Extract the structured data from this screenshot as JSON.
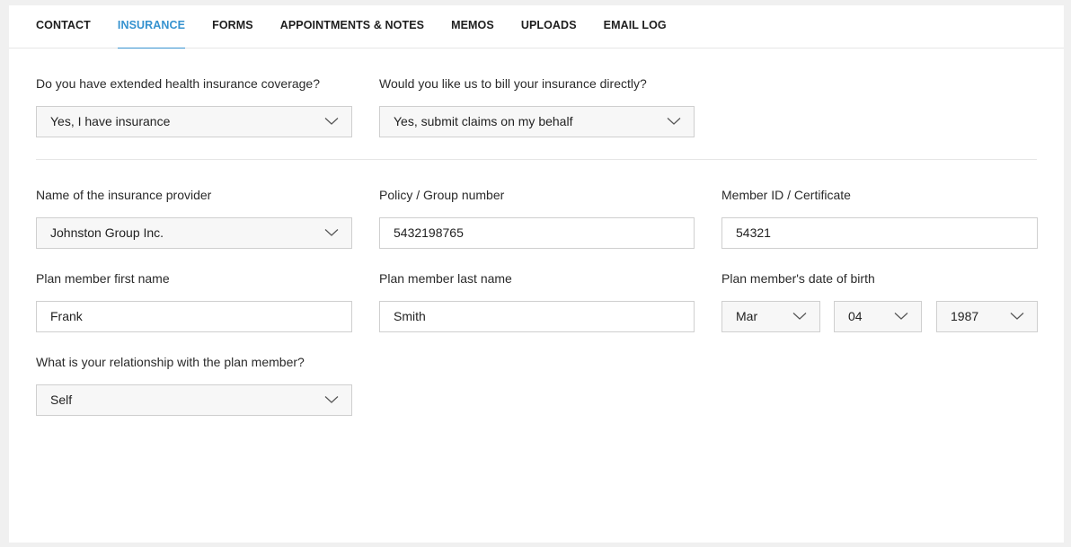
{
  "tabs": [
    {
      "label": "CONTACT",
      "active": false
    },
    {
      "label": "INSURANCE",
      "active": true
    },
    {
      "label": "FORMS",
      "active": false
    },
    {
      "label": "APPOINTMENTS & NOTES",
      "active": false
    },
    {
      "label": "MEMOS",
      "active": false
    },
    {
      "label": "UPLOADS",
      "active": false
    },
    {
      "label": "EMAIL LOG",
      "active": false
    }
  ],
  "coverage": {
    "label": "Do you have extended health insurance coverage?",
    "value": "Yes, I have insurance"
  },
  "billing": {
    "label": "Would you like us to bill your insurance directly?",
    "value": "Yes, submit claims on my behalf"
  },
  "provider": {
    "label": "Name of the insurance provider",
    "value": "Johnston Group Inc."
  },
  "policy": {
    "label": "Policy / Group number",
    "value": "5432198765"
  },
  "member_id": {
    "label": "Member ID / Certificate",
    "value": "54321"
  },
  "first_name": {
    "label": "Plan member first name",
    "value": "Frank"
  },
  "last_name": {
    "label": "Plan member last name",
    "value": "Smith"
  },
  "dob": {
    "label": "Plan member's date of birth",
    "month": "Mar",
    "day": "04",
    "year": "1987"
  },
  "relationship": {
    "label": "What is your relationship with the plan member?",
    "value": "Self"
  },
  "colors": {
    "accent": "#3592cf",
    "border": "#cfcfcf",
    "select_bg": "#f7f7f7"
  }
}
